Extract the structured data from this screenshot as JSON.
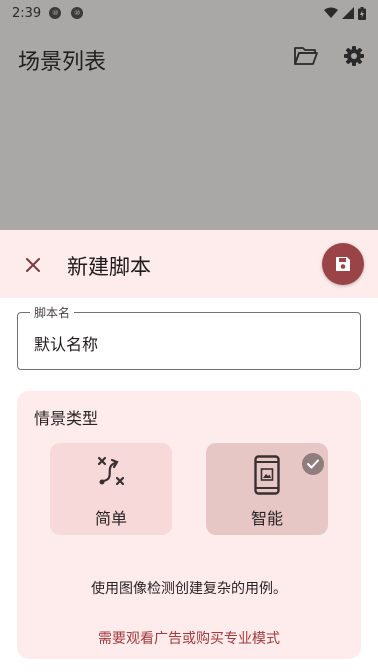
{
  "status_bar": {
    "time": "2:39",
    "notif1": "⑩",
    "notif2": "⑩",
    "icons": [
      "wifi-icon",
      "signal-icon",
      "battery-icon"
    ]
  },
  "background_app": {
    "title": "场景列表",
    "icons": [
      "folder-open-icon",
      "gear-icon"
    ]
  },
  "sheet": {
    "title": "新建脚本",
    "close_icon": "close-icon",
    "save_icon": "save-icon",
    "name_field": {
      "label": "脚本名",
      "value": "默认名称"
    },
    "scenario_type": {
      "title": "情景类型",
      "options": [
        {
          "label": "简单",
          "icon": "route-icon",
          "selected": false
        },
        {
          "label": "智能",
          "icon": "phone-image-icon",
          "selected": true
        }
      ],
      "description": "使用图像检测创建复杂的用例。",
      "upgrade_link": "需要观看广告或购买专业模式"
    }
  },
  "colors": {
    "accent": "#9b4447",
    "sheet_tint": "#fdeceb",
    "scrim": "#aaa7a7",
    "link": "#a33a3d"
  }
}
